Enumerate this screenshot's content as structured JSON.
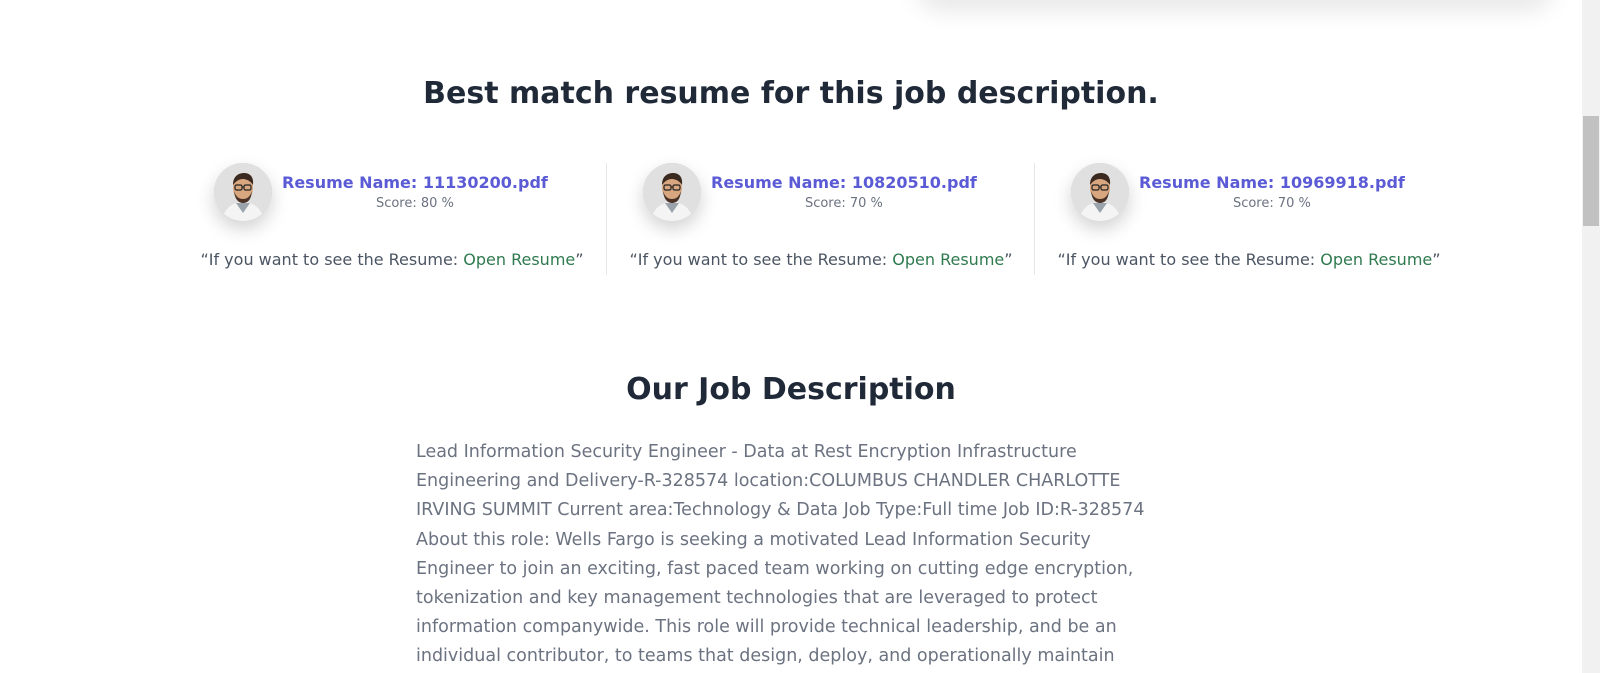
{
  "best_match": {
    "title": "Best match resume for this job description.",
    "resumes": [
      {
        "name_label": "Resume Name: 11130200.pdf",
        "score": "Score: 80 %",
        "quote_prefix": "“If you want to see the Resume: ",
        "link_label": "Open Resume",
        "quote_suffix": "”"
      },
      {
        "name_label": "Resume Name: 10820510.pdf",
        "score": "Score: 70 %",
        "quote_prefix": "“If you want to see the Resume: ",
        "link_label": "Open Resume",
        "quote_suffix": "”"
      },
      {
        "name_label": "Resume Name: 10969918.pdf",
        "score": "Score: 70 %",
        "quote_prefix": "“If you want to see the Resume: ",
        "link_label": "Open Resume",
        "quote_suffix": "”"
      }
    ]
  },
  "job_description": {
    "title": "Our Job Description",
    "text": "Lead Information Security Engineer - Data at Rest Encryption Infrastructure Engineering and Delivery-R-328574 location:COLUMBUS CHANDLER CHARLOTTE IRVING SUMMIT Current area:Technology & Data Job Type:Full time Job ID:R-328574 About this role: Wells Fargo is seeking a motivated Lead Information Security Engineer to join an exciting, fast paced team working on cutting edge encryption, tokenization and key management technologies that are leveraged to protect information companywide. This role will provide technical leadership, and be an individual contributor, to teams that design, deploy, and operationally maintain cryptographic products and services including Hardware Security"
  },
  "icons": {
    "avatar": "avatar-photo-icon"
  },
  "colors": {
    "heading": "#1f2937",
    "resume_name": "#5b5bd6",
    "link": "#2f7a4f",
    "body_text": "#6b7280"
  }
}
